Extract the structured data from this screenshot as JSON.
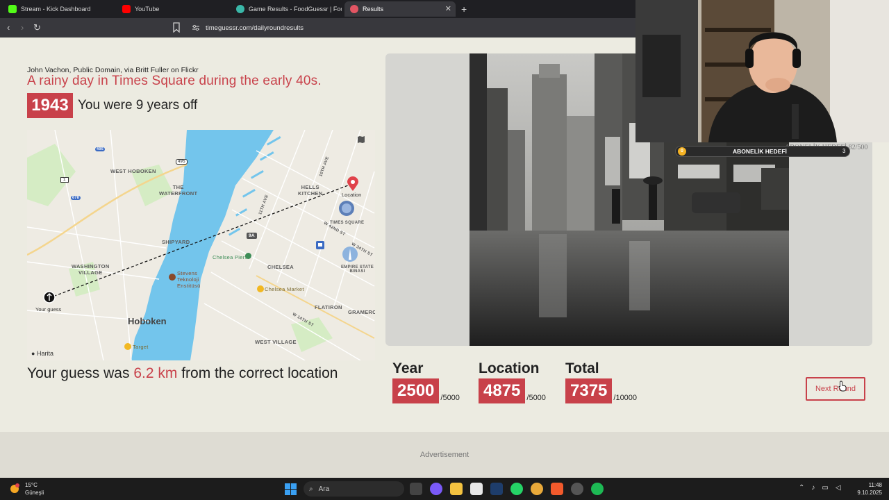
{
  "browser": {
    "tabs": [
      {
        "label": "Stream - Kick Dashboard",
        "favicon_color": "#53fc18"
      },
      {
        "label": "YouTube",
        "favicon_color": "#ff0000"
      },
      {
        "label": "Game Results - FoodGuessr | FoodGu",
        "favicon_color": "#3ab7a8"
      },
      {
        "label": "Results",
        "favicon_color": "#e25563",
        "active": true
      }
    ],
    "url": "timeguessr.com/dailyroundresults"
  },
  "result": {
    "credit": "John Vachon, Public Domain, via Britt Fuller on Flickr",
    "title": "A rainy day in Times Square during the early 40s.",
    "correct_year": "1943",
    "years_off_text": "You were 9 years off",
    "distance_prefix": "Your guess was ",
    "distance_value": "6.2 km",
    "distance_suffix": " from the correct location"
  },
  "map": {
    "labels": {
      "west_hoboken": "WEST HOBOKEN",
      "the_waterfront": "THE\nWATERFRONT",
      "hells_kitchen": "HELLS\nKITCHEN",
      "shipyard": "SHIPYARD",
      "washington_village": "WASHINGTON\nVILLAGE",
      "chelsea": "CHELSEA",
      "hoboken": "Hoboken",
      "flatiron": "FLATIRON",
      "gramercy": "GRAMERCY",
      "west_village": "WEST VILLAGE",
      "times_square": "TIMES SQUARE",
      "empire_state": "EMPIRE STATE\nBINASI",
      "chelsea_piers": "Chelsea Piers",
      "chelsea_market": "Chelsea Market",
      "stevens": "Stevens\nTeknoloji\nEnstitüsü",
      "target": "Target",
      "avenue_10": "10TH AVE",
      "avenue_11": "11TH AVE",
      "st_42": "W 42ND ST",
      "st_34": "W 34TH ST",
      "st_14": "W 14TH ST",
      "route_9a": "9A",
      "route_495": "495",
      "route_1": "1",
      "route_495b": "495",
      "route_678": "678"
    },
    "location_pin_label": "Location",
    "guess_pin_label": "Your guess",
    "watermark": "Harita"
  },
  "scores": [
    {
      "title": "Year",
      "value": "2500",
      "max": "/5000"
    },
    {
      "title": "Location",
      "value": "4875",
      "max": "/5000"
    },
    {
      "title": "Total",
      "value": "7375",
      "max": "/10000"
    }
  ],
  "next_round_label": "Next Round",
  "ad_label": "Advertisement",
  "overlay": {
    "sub_start": "0",
    "sub_label": "ABONELİK HEDEFİ",
    "sub_goal": "3",
    "ghost_text": "ABONELİK HEDEFİ 82/500"
  },
  "taskbar": {
    "temperature": "15°C",
    "weather_desc": "Güneşli",
    "search_placeholder": "Ara",
    "time": "11:48",
    "date": "9.10.2025"
  },
  "colors": {
    "accent": "#c8414a",
    "page_bg": "#ecebe1",
    "water": "#73c5ec"
  }
}
